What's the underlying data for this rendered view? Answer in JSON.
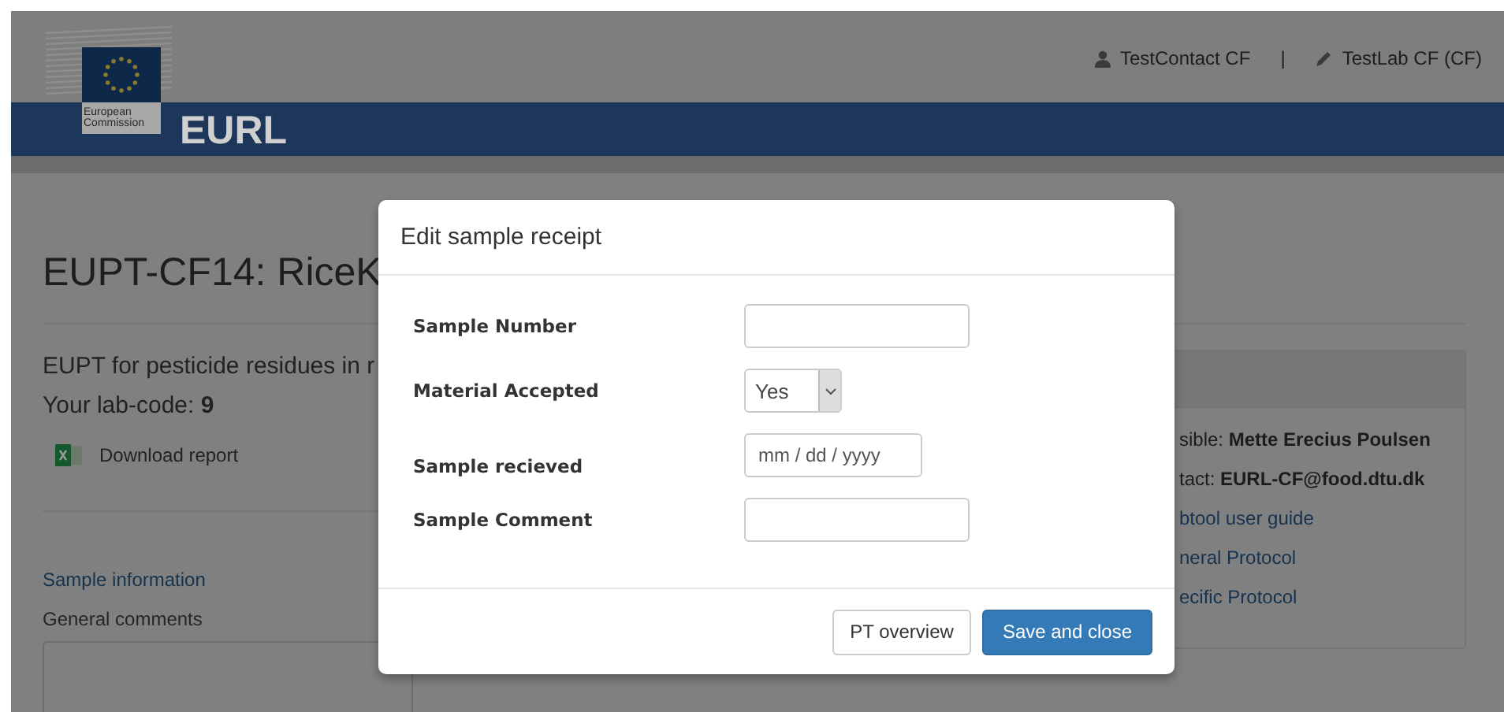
{
  "header": {
    "logo_caption": "European Commission",
    "site_name": "EURL",
    "user": "TestContact CF",
    "separator": "|",
    "lab": "TestLab CF (CF)"
  },
  "page": {
    "title": "EUPT-CF14: RiceK",
    "subtitle": "EUPT for pesticide residues in r",
    "lab_code_label": "Your lab-code:",
    "lab_code": "9",
    "download": "Download report",
    "section_link": "Sample information",
    "comments_label": "General comments"
  },
  "info_panel": {
    "lines": [
      {
        "kind": "text",
        "text": "sible: **Mette Erecius Poulsen**"
      },
      {
        "kind": "text",
        "text": "tact: **EURL-CF@food.dtu.dk**"
      },
      {
        "kind": "link",
        "text": "btool user guide"
      },
      {
        "kind": "link",
        "text": "neral Protocol"
      },
      {
        "kind": "link",
        "text": "ecific Protocol"
      }
    ]
  },
  "modal": {
    "title": "Edit sample receipt",
    "fields": [
      {
        "kind": "text",
        "label": "Sample Number"
      },
      {
        "kind": "select",
        "label": "Material Accepted",
        "value": "Yes"
      },
      {
        "kind": "date",
        "label": "Sample recieved",
        "placeholder": "mm / dd / yyyy"
      },
      {
        "kind": "text",
        "label": "Sample Comment"
      }
    ],
    "buttons": [
      {
        "kind": "default",
        "label": "PT overview"
      },
      {
        "kind": "primary",
        "label": "Save and close"
      }
    ]
  }
}
